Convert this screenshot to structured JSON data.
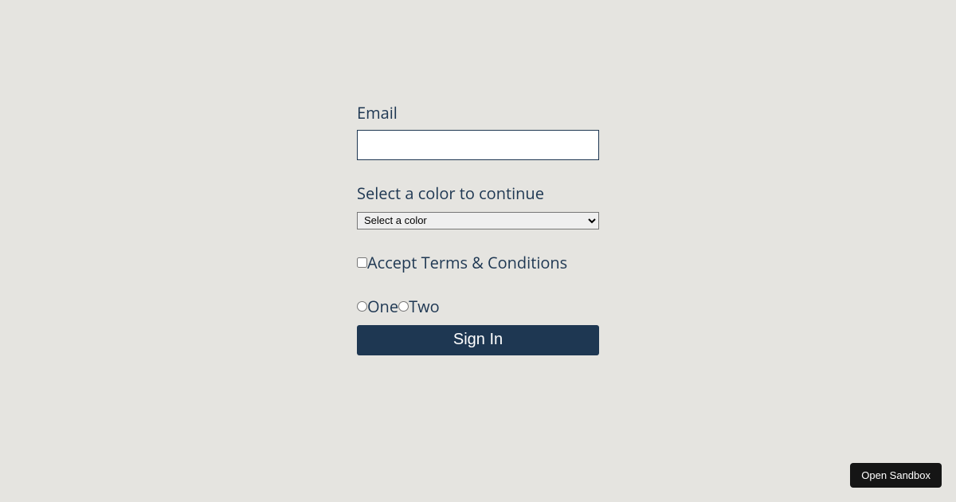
{
  "form": {
    "email": {
      "label": "Email",
      "value": ""
    },
    "color": {
      "label": "Select a color to continue",
      "placeholder": "Select a color",
      "selected": "Select a color"
    },
    "terms": {
      "label": "Accept Terms & Conditions",
      "checked": false
    },
    "radio": {
      "options": [
        {
          "label": "One",
          "value": "one"
        },
        {
          "label": "Two",
          "value": "two"
        }
      ]
    },
    "submit": {
      "label": "Sign In"
    }
  },
  "sandbox": {
    "label": "Open Sandbox"
  }
}
